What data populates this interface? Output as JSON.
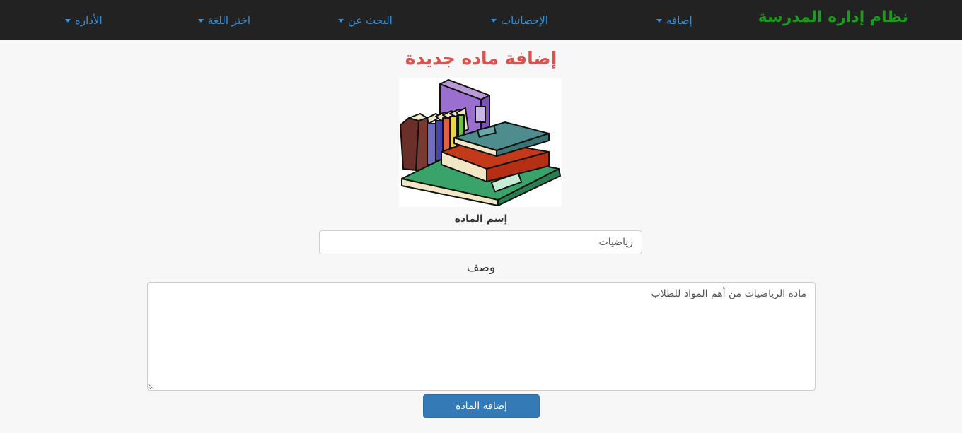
{
  "navbar": {
    "brand": "نظام إداره المدرسة",
    "items": [
      {
        "label": "إضافه"
      },
      {
        "label": "الإحصائيات"
      },
      {
        "label": "البحث عن"
      },
      {
        "label": "اختر اللغة"
      },
      {
        "label": "الأداره"
      }
    ]
  },
  "main": {
    "title": "إضافة ماده جديدة",
    "image_icon": "books-illustration",
    "subject_name_label": "إسم الماده",
    "subject_name_value": "رياضيات",
    "description_label": "وصف",
    "description_value": "ماده الرياضيات من أهم المواد للطلاب",
    "submit_label": "إضافه الماده"
  },
  "colors": {
    "navbar_bg": "#222222",
    "brand": "#1d9a1d",
    "nav_link": "#3a8fd4",
    "title": "#d9534f",
    "button": "#337ab7"
  }
}
